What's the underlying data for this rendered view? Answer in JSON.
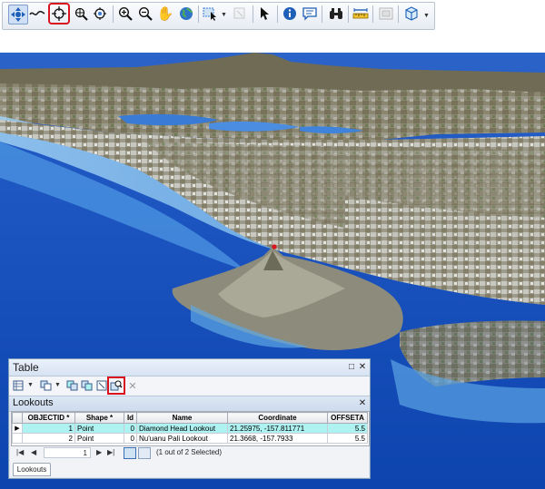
{
  "toolbar": {
    "tools": [
      {
        "name": "navigate",
        "icon": "navigate-icon"
      },
      {
        "name": "fly",
        "icon": "fly-icon"
      },
      {
        "name": "center-on-target",
        "icon": "target-icon",
        "highlighted": true
      },
      {
        "name": "zoom-to-target",
        "icon": "zoom-target-icon"
      },
      {
        "name": "set-observer",
        "icon": "observer-icon"
      },
      {
        "name": "zoom-in",
        "icon": "zoom-in-icon"
      },
      {
        "name": "zoom-out",
        "icon": "zoom-out-icon"
      },
      {
        "name": "pan",
        "icon": "hand-icon"
      },
      {
        "name": "full-extent",
        "icon": "globe-icon"
      },
      {
        "name": "select-features",
        "icon": "select-features-icon"
      },
      {
        "name": "clear-selection",
        "icon": "clear-selection-icon"
      },
      {
        "name": "select-elements",
        "icon": "arrow-cursor-icon"
      },
      {
        "name": "identify",
        "icon": "info-icon"
      },
      {
        "name": "html-popup",
        "icon": "popup-icon"
      },
      {
        "name": "find",
        "icon": "binoculars-icon"
      },
      {
        "name": "measure",
        "icon": "measure-icon"
      },
      {
        "name": "animation",
        "icon": "animation-icon"
      },
      {
        "name": "scene-properties",
        "icon": "cube-icon"
      }
    ]
  },
  "table_window": {
    "title": "Table",
    "tab_title": "Lookouts",
    "bottom_tab": "Lookouts",
    "columns": [
      "OBJECTID *",
      "Shape *",
      "Id",
      "Name",
      "Coordinate",
      "OFFSETA"
    ],
    "rows": [
      {
        "cells": [
          "1",
          "Point",
          "0",
          "Diamond Head Lookout",
          "21.25975, -157.811771",
          "5.5"
        ],
        "selected": true,
        "current": true
      },
      {
        "cells": [
          "2",
          "Point",
          "0",
          "Nu'uanu Pali Lookout",
          "21.3668, -157.7933",
          "5.5"
        ],
        "selected": false,
        "current": false
      }
    ],
    "record_number": "1",
    "status": "(1 out of 2 Selected)"
  },
  "colors": {
    "highlight": "#d8141e",
    "selected_row": "#aef2f2",
    "ocean_deep": "#0a3fa8",
    "ocean_shallow": "#7ec0ea",
    "sky": "#ffffff"
  }
}
